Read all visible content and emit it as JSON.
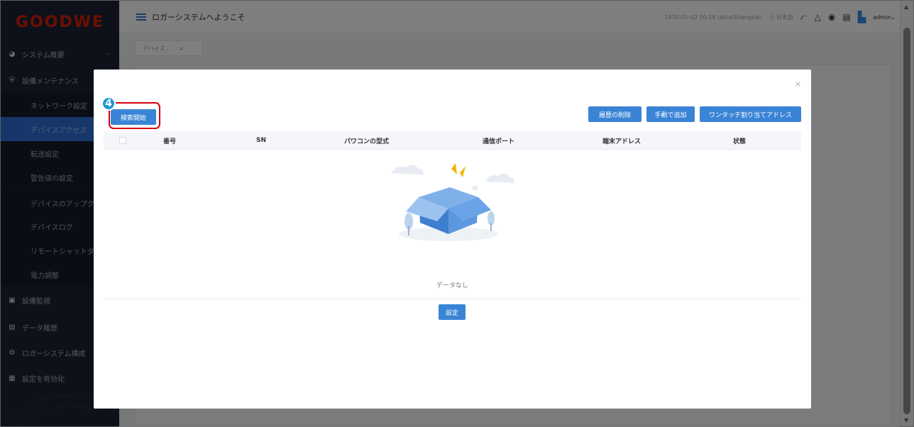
{
  "brand": {
    "logo_text": "GOODWE",
    "accent": "#3a84d6",
    "logo_color": "#d81e06"
  },
  "header": {
    "title": "ロガーシステムへようこそ",
    "datetime": "1970-01-02 00:18 (Asia/Shanghai)",
    "language": "日本語",
    "user": "admin",
    "icons": [
      "menu-icon",
      "clock-icon",
      "signal-icon",
      "alert-icon",
      "record-icon",
      "document-icon",
      "user-logo-icon"
    ]
  },
  "sidebar": {
    "items": [
      {
        "label": "システム概要",
        "icon": "pie-icon",
        "chevron": "⌄"
      },
      {
        "label": "設備メンテナンス",
        "icon": "shield-icon"
      },
      {
        "label": "設備監視",
        "icon": "monitor-icon"
      },
      {
        "label": "データ履歴",
        "icon": "history-icon"
      },
      {
        "label": "ロガーシステム構成",
        "icon": "gear-icon"
      },
      {
        "label": "設定を有効化",
        "icon": "save-icon"
      }
    ],
    "sub_items": [
      {
        "label": "ネットワーク設定"
      },
      {
        "label": "デバイスアクセス",
        "active": true
      },
      {
        "label": "転送設定"
      },
      {
        "label": "警告値の設定"
      },
      {
        "label": "デバイスのアップグレ"
      },
      {
        "label": "デバイスログ"
      },
      {
        "label": "リモートシャットダウ"
      },
      {
        "label": "電力調整"
      }
    ]
  },
  "tabs": [
    {
      "label": "デバイス...",
      "close": "×"
    }
  ],
  "modal": {
    "close": "×",
    "step_badge": "4",
    "buttons": {
      "search": "検索開始",
      "clear_history": "履歴の削除",
      "manual_add": "手動で追加",
      "one_touch": "ワンタッチ割り当てアドレス",
      "confirm": "設定"
    },
    "columns": [
      "番号",
      "SN",
      "パワコンの型式",
      "通信ポート",
      "端末アドレス",
      "状態"
    ],
    "rows": [],
    "empty_text": "データなし"
  }
}
